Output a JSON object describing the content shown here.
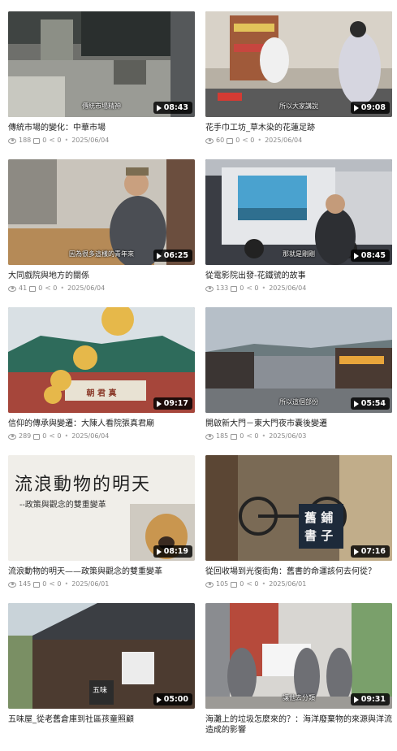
{
  "videos": [
    {
      "title": "傳統市場的變化：中華市場",
      "duration": "08:43",
      "views": "188",
      "comments": "0",
      "shares": "0",
      "date": "2025/06/04",
      "caption": "傳統市場精神"
    },
    {
      "title": "花手巾工坊_草木染的花蓮足跡",
      "duration": "09:08",
      "views": "60",
      "comments": "0",
      "shares": "0",
      "date": "2025/06/04",
      "caption": "所以大家講說"
    },
    {
      "title": "大同戲院與地方的關係",
      "duration": "06:25",
      "views": "41",
      "comments": "0",
      "shares": "0",
      "date": "2025/06/04",
      "caption": "因為很多這樣的青年來"
    },
    {
      "title": "從電影院出發-花鐵號的故事",
      "duration": "08:45",
      "views": "133",
      "comments": "0",
      "shares": "0",
      "date": "2025/06/04",
      "caption": "那就是剛剛"
    },
    {
      "title": "信仰的傳承與變遷：大陳人看院張真君廟",
      "duration": "09:17",
      "views": "289",
      "comments": "0",
      "shares": "0",
      "date": "2025/06/04",
      "caption": ""
    },
    {
      "title": "開啟新大門－東大門夜市囊後變遷",
      "duration": "05:54",
      "views": "185",
      "comments": "0",
      "shares": "0",
      "date": "2025/06/03",
      "caption": "所以這個部份"
    },
    {
      "title": "流浪動物的明天——政策與觀念的雙重變革",
      "duration": "08:19",
      "views": "145",
      "comments": "0",
      "shares": "0",
      "date": "2025/06/01",
      "caption": ""
    },
    {
      "title": "從回收場到光復街角：舊書的命運該何去何從？",
      "duration": "07:16",
      "views": "105",
      "comments": "0",
      "shares": "0",
      "date": "2025/06/01",
      "caption": ""
    },
    {
      "title": "五味屋_從老舊倉庫到社區孩童照顧",
      "duration": "05:00",
      "views": "",
      "comments": "",
      "shares": "",
      "date": "",
      "caption": ""
    },
    {
      "title": "海灘上的垃圾怎麼來的？：海洋廢棄物的來源與洋流造成的影響",
      "duration": "09:31",
      "views": "",
      "comments": "",
      "shares": "",
      "date": "",
      "caption": "讓他去分類"
    }
  ],
  "thumb_texts": {
    "temple_sign": "朝 君 真",
    "stray_line1": "流浪動物的明天",
    "stray_line2": "--政策與觀念的雙重變革",
    "bookshop_sign_1": "舊 鋪",
    "bookshop_sign_2": "書 子",
    "wuwei_sign": "五味"
  }
}
